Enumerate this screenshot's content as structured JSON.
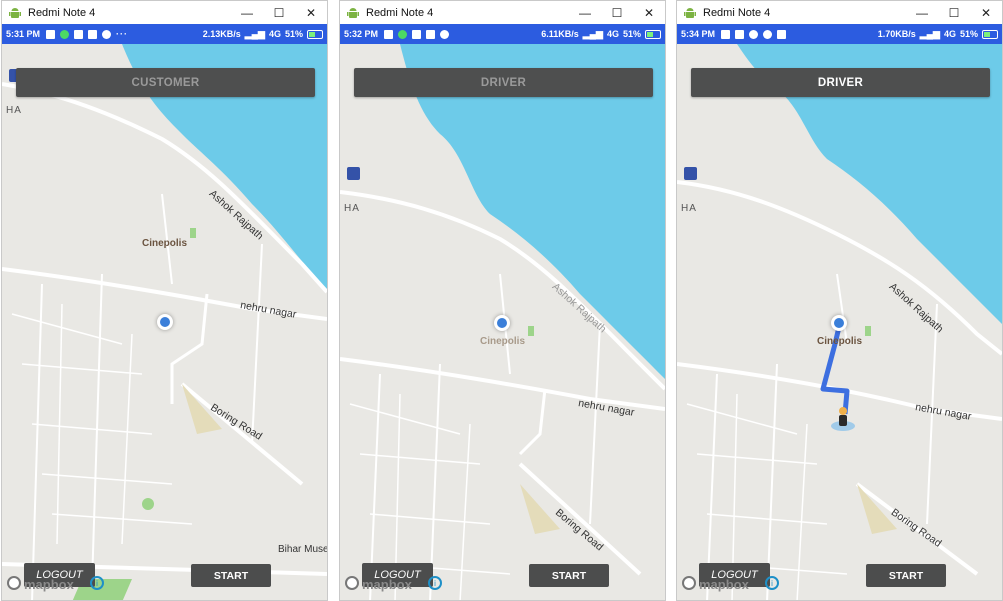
{
  "windows": [
    {
      "title": "Redmi Note 4",
      "status": {
        "time": "5:31 PM",
        "speed": "2.13KB/s",
        "network": "4G",
        "battery": "51%"
      },
      "role_button": "CUSTOMER",
      "role_active": false,
      "labels": {
        "road1": "Ashok Rajpath",
        "road2": "nehru nagar",
        "road3": "Boring Road",
        "poi": "Cinepolis",
        "museum": "Bihar Muse",
        "ha": "HA"
      },
      "logout": "LOGOUT",
      "start": "START",
      "mapbox": "mapbox"
    },
    {
      "title": "Redmi Note 4",
      "status": {
        "time": "5:32 PM",
        "speed": "6.11KB/s",
        "network": "4G",
        "battery": "51%"
      },
      "role_button": "DRIVER",
      "role_active": false,
      "labels": {
        "road1": "Ashok Rajpath",
        "road2": "nehru nagar",
        "road3": "Boring Road",
        "poi": "Cinepolis",
        "ha": "HA"
      },
      "logout": "LOGOUT",
      "start": "START",
      "mapbox": "mapbox"
    },
    {
      "title": "Redmi Note 4",
      "status": {
        "time": "5:34 PM",
        "speed": "1.70KB/s",
        "network": "4G",
        "battery": "51%"
      },
      "role_button": "DRIVER",
      "role_active": true,
      "labels": {
        "road1": "Ashok Rajpath",
        "road2": "nehru nagar",
        "road3": "Boring Road",
        "poi": "Cinepolis",
        "ha": "HA"
      },
      "logout": "LOGOUT",
      "start": "START",
      "mapbox": "mapbox"
    }
  ],
  "colors": {
    "status_bar": "#2c5ce0",
    "water": "#6dcbe9",
    "land": "#e9e8e4",
    "route": "#3d6fe0",
    "location": "#3b7fd9"
  }
}
